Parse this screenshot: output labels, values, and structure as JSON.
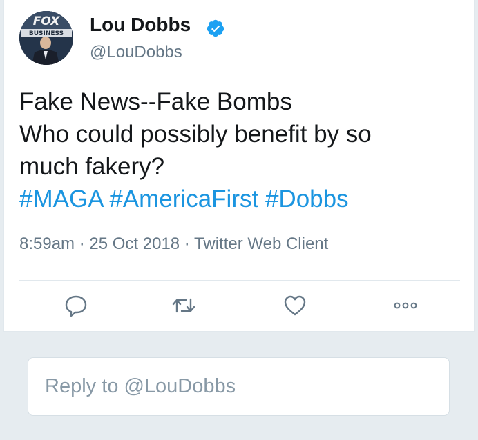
{
  "author": {
    "display_name": "Lou Dobbs",
    "handle": "@LouDobbs",
    "verified": true,
    "avatar_logo_text": "FOX BUSINESS"
  },
  "tweet": {
    "text_lines": [
      "Fake News--Fake Bombs",
      "Who could possibly benefit by so",
      "much fakery?"
    ],
    "hashtags": [
      "#MAGA",
      "#AmericaFirst",
      "#Dobbs"
    ],
    "meta": "8:59am · 25 Oct 2018 · Twitter Web Client"
  },
  "actions": {
    "reply_icon": "reply-icon",
    "retweet_icon": "retweet-icon",
    "like_icon": "heart-icon",
    "more_icon": "more-icon"
  },
  "reply": {
    "placeholder": "Reply to @LouDobbs"
  },
  "colors": {
    "link": "#1b95e0",
    "verified": "#1da1f2",
    "muted_text": "#657786",
    "primary_text": "#14171a",
    "background": "#e6ecf0"
  }
}
